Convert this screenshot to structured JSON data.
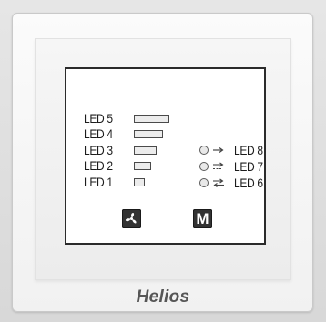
{
  "device": {
    "brand": "Helios",
    "bar_leds": [
      {
        "label": "LED 5"
      },
      {
        "label": "LED 4"
      },
      {
        "label": "LED 3"
      },
      {
        "label": "LED 2"
      },
      {
        "label": "LED 1"
      }
    ],
    "mode_leds": [
      {
        "label": "LED 8",
        "icon": "arrow-right-icon"
      },
      {
        "label": "LED 7",
        "icon": "dashed-arrow-right-icon"
      },
      {
        "label": "LED 6",
        "icon": "bidirectional-arrows-icon"
      }
    ],
    "buttons": {
      "fan_icon": "fan-icon",
      "mode_label": "M"
    }
  }
}
